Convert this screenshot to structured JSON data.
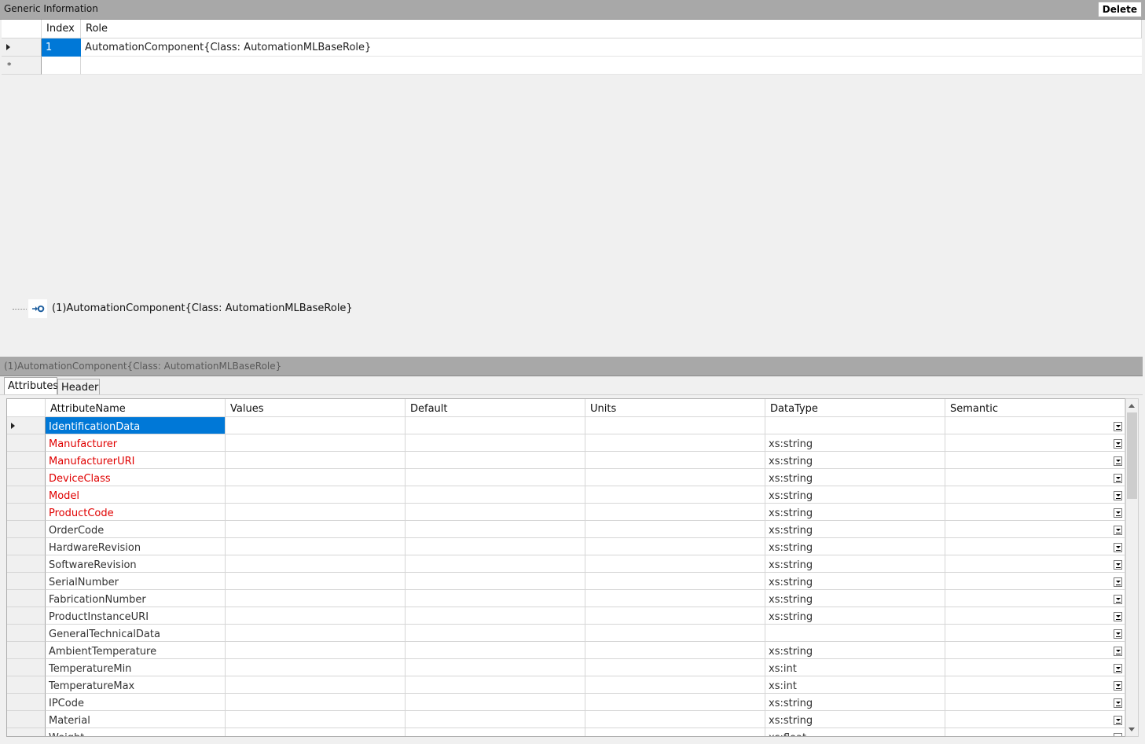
{
  "generic": {
    "title": "Generic Information",
    "delete_label": "Delete",
    "columns": [
      "Index",
      "Role"
    ],
    "rows": [
      {
        "index": "1",
        "role": "AutomationComponent{Class:  AutomationMLBaseRole}"
      }
    ],
    "new_row_marker": "*"
  },
  "tree": {
    "node_label": "(1)AutomationComponent{Class:  AutomationMLBaseRole}",
    "node_icon": "role-link-icon"
  },
  "detail": {
    "title": "(1)AutomationComponent{Class:  AutomationMLBaseRole}",
    "tabs": [
      "Attributes",
      "Header"
    ],
    "active_tab": "Attributes"
  },
  "attributes": {
    "columns": [
      "AttributeName",
      "Values",
      "Default",
      "Units",
      "DataType",
      "Semantic"
    ],
    "rows": [
      {
        "name": "IdentificationData",
        "type": "",
        "required": false,
        "selected": true
      },
      {
        "name": "Manufacturer",
        "type": "xs:string",
        "required": true
      },
      {
        "name": "ManufacturerURI",
        "type": "xs:string",
        "required": true
      },
      {
        "name": "DeviceClass",
        "type": "xs:string",
        "required": true
      },
      {
        "name": "Model",
        "type": "xs:string",
        "required": true
      },
      {
        "name": "ProductCode",
        "type": "xs:string",
        "required": true
      },
      {
        "name": "OrderCode",
        "type": "xs:string",
        "required": false
      },
      {
        "name": "HardwareRevision",
        "type": "xs:string",
        "required": false
      },
      {
        "name": "SoftwareRevision",
        "type": "xs:string",
        "required": false
      },
      {
        "name": "SerialNumber",
        "type": "xs:string",
        "required": false
      },
      {
        "name": "FabricationNumber",
        "type": "xs:string",
        "required": false
      },
      {
        "name": "ProductInstanceURI",
        "type": "xs:string",
        "required": false
      },
      {
        "name": "GeneralTechnicalData",
        "type": "",
        "required": false
      },
      {
        "name": "AmbientTemperature",
        "type": "xs:string",
        "required": false
      },
      {
        "name": "TemperatureMin",
        "type": "xs:int",
        "required": false
      },
      {
        "name": "TemperatureMax",
        "type": "xs:int",
        "required": false
      },
      {
        "name": "IPCode",
        "type": "xs:string",
        "required": false
      },
      {
        "name": "Material",
        "type": "xs:string",
        "required": false
      },
      {
        "name": "Weight",
        "type": "xs:float",
        "required": false
      }
    ]
  },
  "colors": {
    "selection": "#0078d7",
    "required_text": "#e00000",
    "header_bar": "#a8a8a8"
  }
}
